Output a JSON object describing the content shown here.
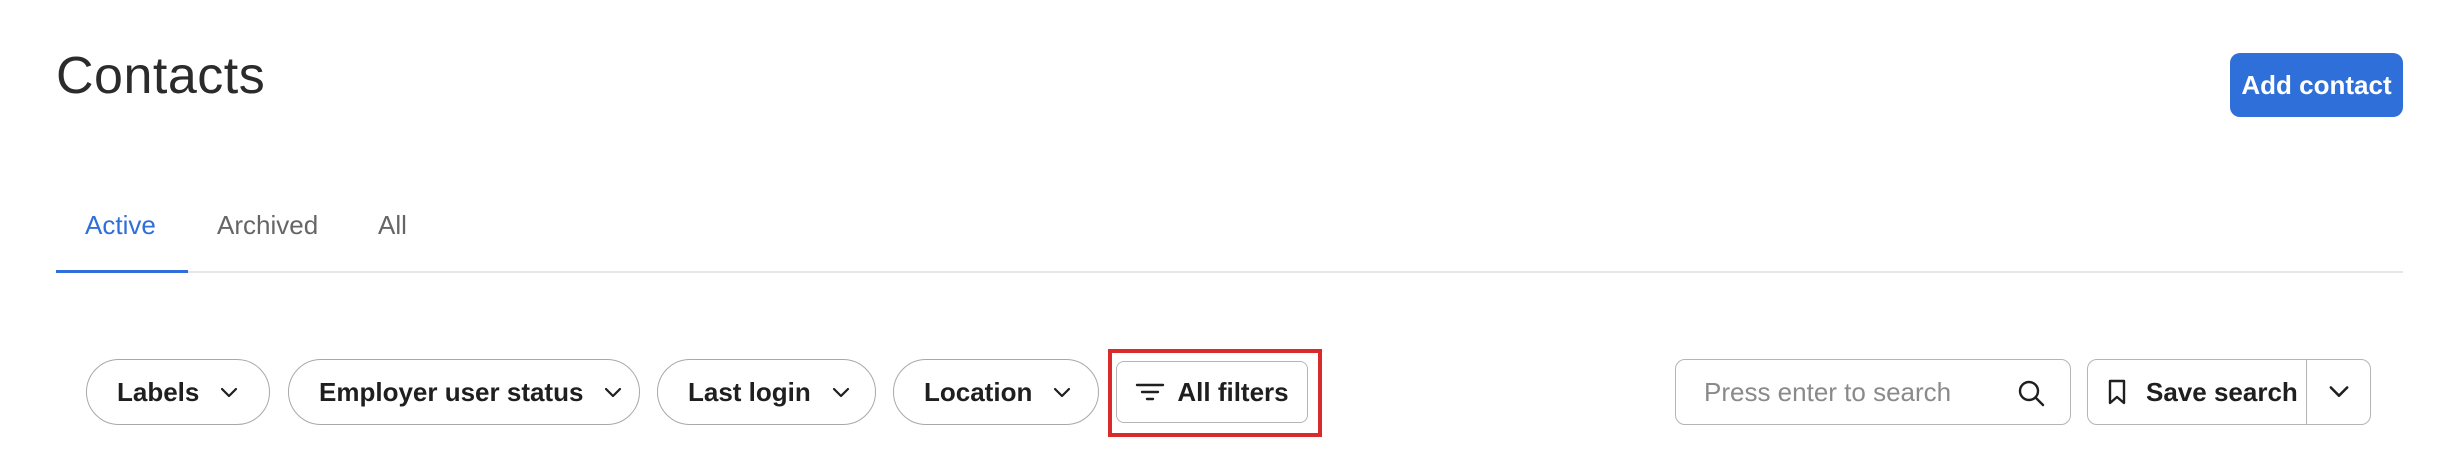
{
  "page": {
    "title": "Contacts",
    "add_button_label": "Add contact"
  },
  "tabs": [
    {
      "label": "Active",
      "active": true
    },
    {
      "label": "Archived",
      "active": false
    },
    {
      "label": "All",
      "active": false
    }
  ],
  "filters": {
    "labels": "Labels",
    "employer_user_status": "Employer user status",
    "last_login": "Last login",
    "location": "Location",
    "all_filters": "All filters"
  },
  "search": {
    "placeholder": "Press enter to search",
    "value": ""
  },
  "save_search": {
    "label": "Save search"
  },
  "colors": {
    "accent": "#2f6fd9",
    "highlight": "#d92b2b",
    "border": "#b5b5b5"
  },
  "icons": {
    "chevron": "chevron-down-icon",
    "filter": "filter-lines-icon",
    "search": "search-icon",
    "bookmark": "bookmark-icon"
  }
}
